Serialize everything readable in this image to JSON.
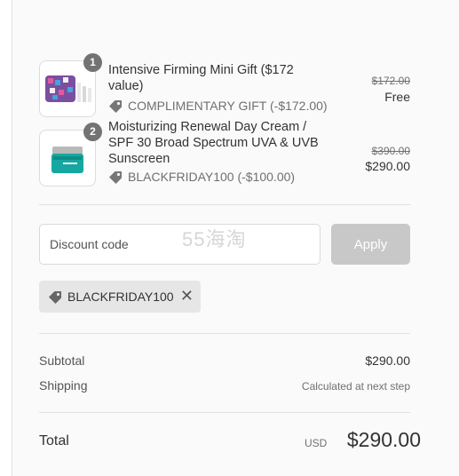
{
  "items": [
    {
      "quantity": "1",
      "title": "Intensive Firming Mini Gift ($172 value)",
      "discount": "COMPLIMENTARY GIFT (-$172.00)",
      "original_price": "$172.00",
      "price": "Free"
    },
    {
      "quantity": "2",
      "title": "Moisturizing Renewal Day Cream / SPF 30 Broad Spectrum UVA & UVB Sunscreen",
      "discount": "BLACKFRIDAY100 (-$100.00)",
      "original_price": "$390.00",
      "price": "$290.00"
    }
  ],
  "discount_code": {
    "placeholder": "Discount code",
    "value": "",
    "apply_label": "Apply",
    "watermark": "55海淘"
  },
  "applied_code": "BLACKFRIDAY100",
  "summary": {
    "subtotal_label": "Subtotal",
    "subtotal_value": "$290.00",
    "shipping_label": "Shipping",
    "shipping_value": "Calculated at next step"
  },
  "total": {
    "label": "Total",
    "currency": "USD",
    "value": "$290.00"
  },
  "icons": {
    "tag": "tag-icon",
    "remove": "close-icon"
  },
  "colors": {
    "panel_bg": "#fafafa",
    "apply_disabled": "#c8c8c8",
    "qty_badge": "#737373"
  }
}
